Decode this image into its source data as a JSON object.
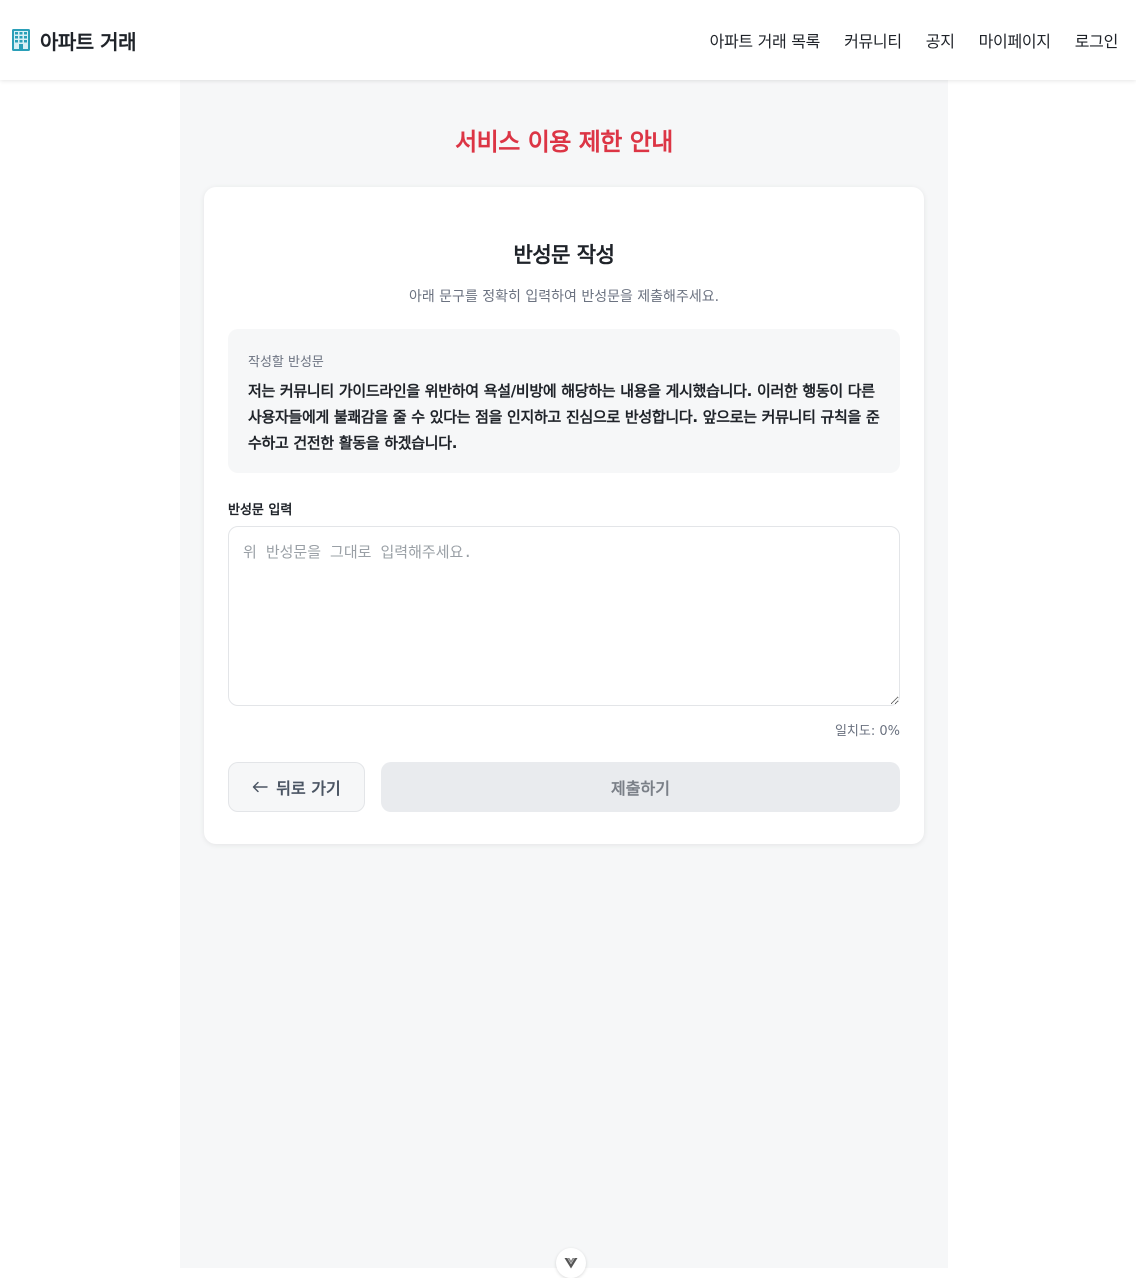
{
  "header": {
    "brand": "아파트 거래",
    "brand_icon": "building-icon",
    "nav": [
      "아파트 거래 목록",
      "커뮤니티",
      "공지",
      "마이페이지",
      "로그인"
    ]
  },
  "page": {
    "title": "서비스 이용 제한 안내",
    "title_color": "#dc3545"
  },
  "card": {
    "title": "반성문 작성",
    "description": "아래 문구를 정확히 입력하여 반성문을 제출해주세요.",
    "statement_label": "작성할 반성문",
    "statement_text": "저는 커뮤니티 가이드라인을 위반하여 욕설/비방에 해당하는 내용을 게시했습니다. 이러한 행동이 다른 사용자들에게 불쾌감을 줄 수 있다는 점을 인지하고 진심으로 반성합니다. 앞으로는 커뮤니티 규칙을 준수하고 건전한 활동을 하겠습니다.",
    "input_label": "반성문 입력",
    "input_placeholder": "위 반성문을 그대로 입력해주세요.",
    "input_value": "",
    "match_rate": "일치도: 0%",
    "back_label": "뒤로 가기",
    "back_icon": "arrow-left-icon",
    "submit_label": "제출하기"
  },
  "devtools_icon": "vue-devtools-icon"
}
